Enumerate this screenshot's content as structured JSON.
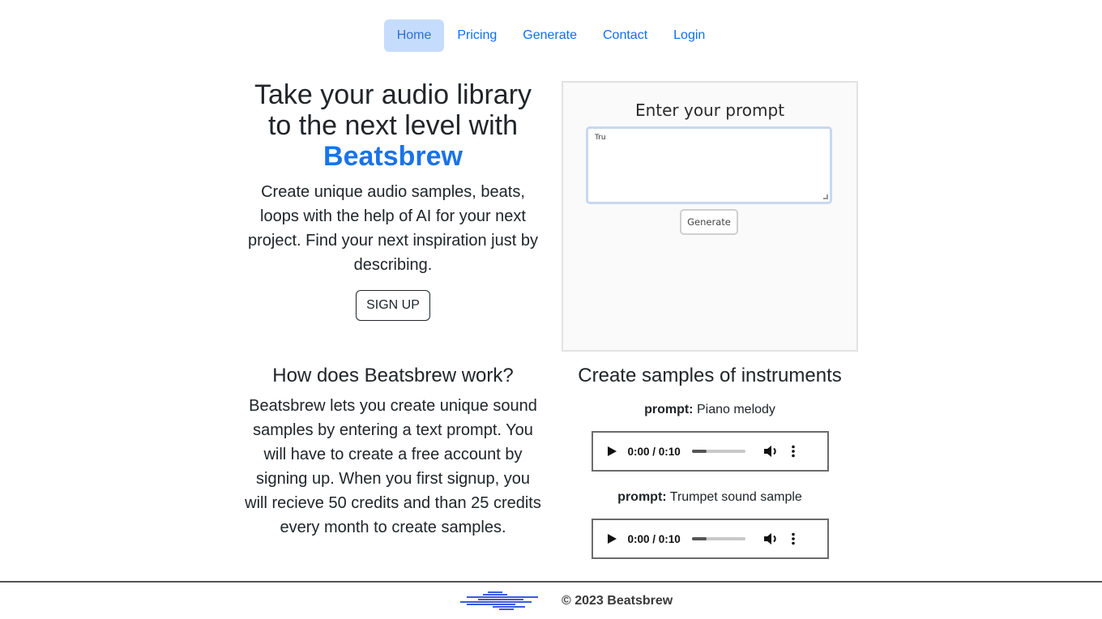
{
  "nav": {
    "items": [
      {
        "label": "Home",
        "active": true
      },
      {
        "label": "Pricing",
        "active": false
      },
      {
        "label": "Generate",
        "active": false
      },
      {
        "label": "Contact",
        "active": false
      },
      {
        "label": "Login",
        "active": false
      }
    ]
  },
  "hero": {
    "title_line": "Take your audio library to the next level with",
    "brand": "Beatsbrew",
    "description": "Create unique audio samples, beats, loops with the help of AI for your next project. Find your next inspiration just by describing.",
    "signup_label": "SIGN UP"
  },
  "prompt_panel": {
    "title": "Enter your prompt",
    "input_value": "Tru",
    "generate_label": "Generate"
  },
  "how": {
    "title": "How does Beatsbrew work?",
    "description": "Beatsbrew lets you create unique sound samples by entering a text prompt. You will have to create a free account by signing up. When you first signup, you will recieve 50 credits and than 25 credits every month to create samples."
  },
  "samples": {
    "title": "Create samples of instruments",
    "prompt_label": "prompt:",
    "items": [
      {
        "prompt": "Piano melody",
        "time": "0:00 / 0:10",
        "buffered_fraction": 0.28
      },
      {
        "prompt": "Trumpet sound sample",
        "time": "0:00 / 0:10",
        "buffered_fraction": 0.28
      }
    ]
  },
  "footer": {
    "copyright": "© 2023 Beatsbrew",
    "logo_color": "#3b5bdb"
  },
  "colors": {
    "accent": "#1a73e8",
    "nav_active_bg": "#c6dcfc"
  }
}
